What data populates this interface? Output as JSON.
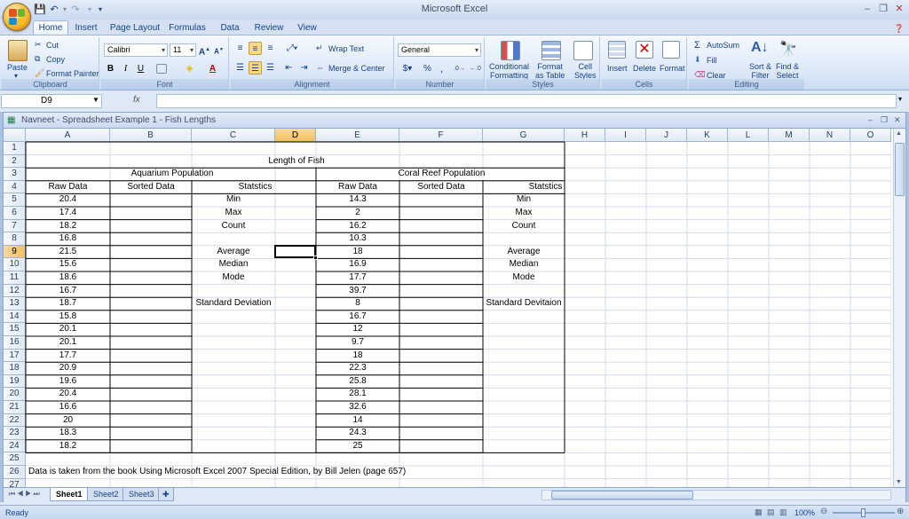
{
  "app": {
    "title": "Microsoft Excel"
  },
  "ribbon": {
    "tabs": [
      "Home",
      "Insert",
      "Page Layout",
      "Formulas",
      "Data",
      "Review",
      "View"
    ],
    "clipboard": {
      "paste": "Paste",
      "cut": "Cut",
      "copy": "Copy",
      "format_painter": "Format Painter",
      "label": "Clipboard"
    },
    "font": {
      "name": "Calibri",
      "size": "11",
      "label": "Font"
    },
    "alignment": {
      "wrap": "Wrap Text",
      "merge": "Merge & Center",
      "label": "Alignment"
    },
    "number": {
      "format": "General",
      "label": "Number"
    },
    "styles": {
      "conditional": "Conditional\nFormatting",
      "format_table": "Format\nas Table",
      "cell_styles": "Cell\nStyles",
      "label": "Styles"
    },
    "cells": {
      "insert": "Insert",
      "delete": "Delete",
      "format": "Format",
      "label": "Cells"
    },
    "editing": {
      "autosum": "AutoSum",
      "fill": "Fill",
      "clear": "Clear",
      "sort": "Sort &\nFilter",
      "find": "Find &\nSelect",
      "label": "Editing"
    }
  },
  "formula_bar": {
    "name_box": "D9",
    "fx": "fx",
    "value": ""
  },
  "workbook": {
    "title": "Navneet - Spreadsheet Example 1 - Fish Lengths"
  },
  "sheet": {
    "columns": [
      "A",
      "B",
      "C",
      "D",
      "E",
      "F",
      "G",
      "H",
      "I",
      "J",
      "K",
      "L",
      "M",
      "N",
      "O"
    ],
    "rows": [
      "1",
      "2",
      "3",
      "4",
      "5",
      "6",
      "7",
      "8",
      "9",
      "10",
      "11",
      "12",
      "13",
      "14",
      "15",
      "16",
      "17",
      "18",
      "19",
      "20",
      "21",
      "22",
      "23",
      "24",
      "25",
      "26",
      "27"
    ],
    "title": "Length of Fish",
    "aquarium_header": "Aquarium Population",
    "coral_header": "Coral Reef Population",
    "col_headers": {
      "raw": "Raw Data",
      "sorted": "Sorted Data",
      "stats": "Statstics"
    },
    "stat_labels_left": {
      "min": "Min",
      "max": "Max",
      "count": "Count",
      "average": "Average",
      "median": "Median",
      "mode": "Mode",
      "stdev": "Standard Deviation"
    },
    "stat_labels_right": {
      "min": "Min",
      "max": "Max",
      "count": "Count",
      "average": "Average",
      "median": "Median",
      "mode": "Mode",
      "stdev": "Standard Devitaion"
    },
    "aquarium_raw": [
      "20.4",
      "17.4",
      "18.2",
      "16.8",
      "21.5",
      "15.6",
      "18.6",
      "16.7",
      "18.7",
      "15.8",
      "20.1",
      "20.1",
      "17.7",
      "20.9",
      "19.6",
      "20.4",
      "16.6",
      "20",
      "18.3",
      "18.2"
    ],
    "coral_raw": [
      "14.3",
      "2",
      "16.2",
      "10.3",
      "18",
      "16.9",
      "17.7",
      "39.7",
      "8",
      "16.7",
      "12",
      "9.7",
      "18",
      "22.3",
      "25.8",
      "28.1",
      "32.6",
      "14",
      "24.3",
      "25"
    ],
    "footnote": "Data is taken from the book Using Microsoft Excel 2007 Special Edition, by Bill Jelen (page 657)"
  },
  "sheet_tabs": [
    "Sheet1",
    "Sheet2",
    "Sheet3"
  ],
  "status": {
    "ready": "Ready",
    "zoom": "100%"
  }
}
